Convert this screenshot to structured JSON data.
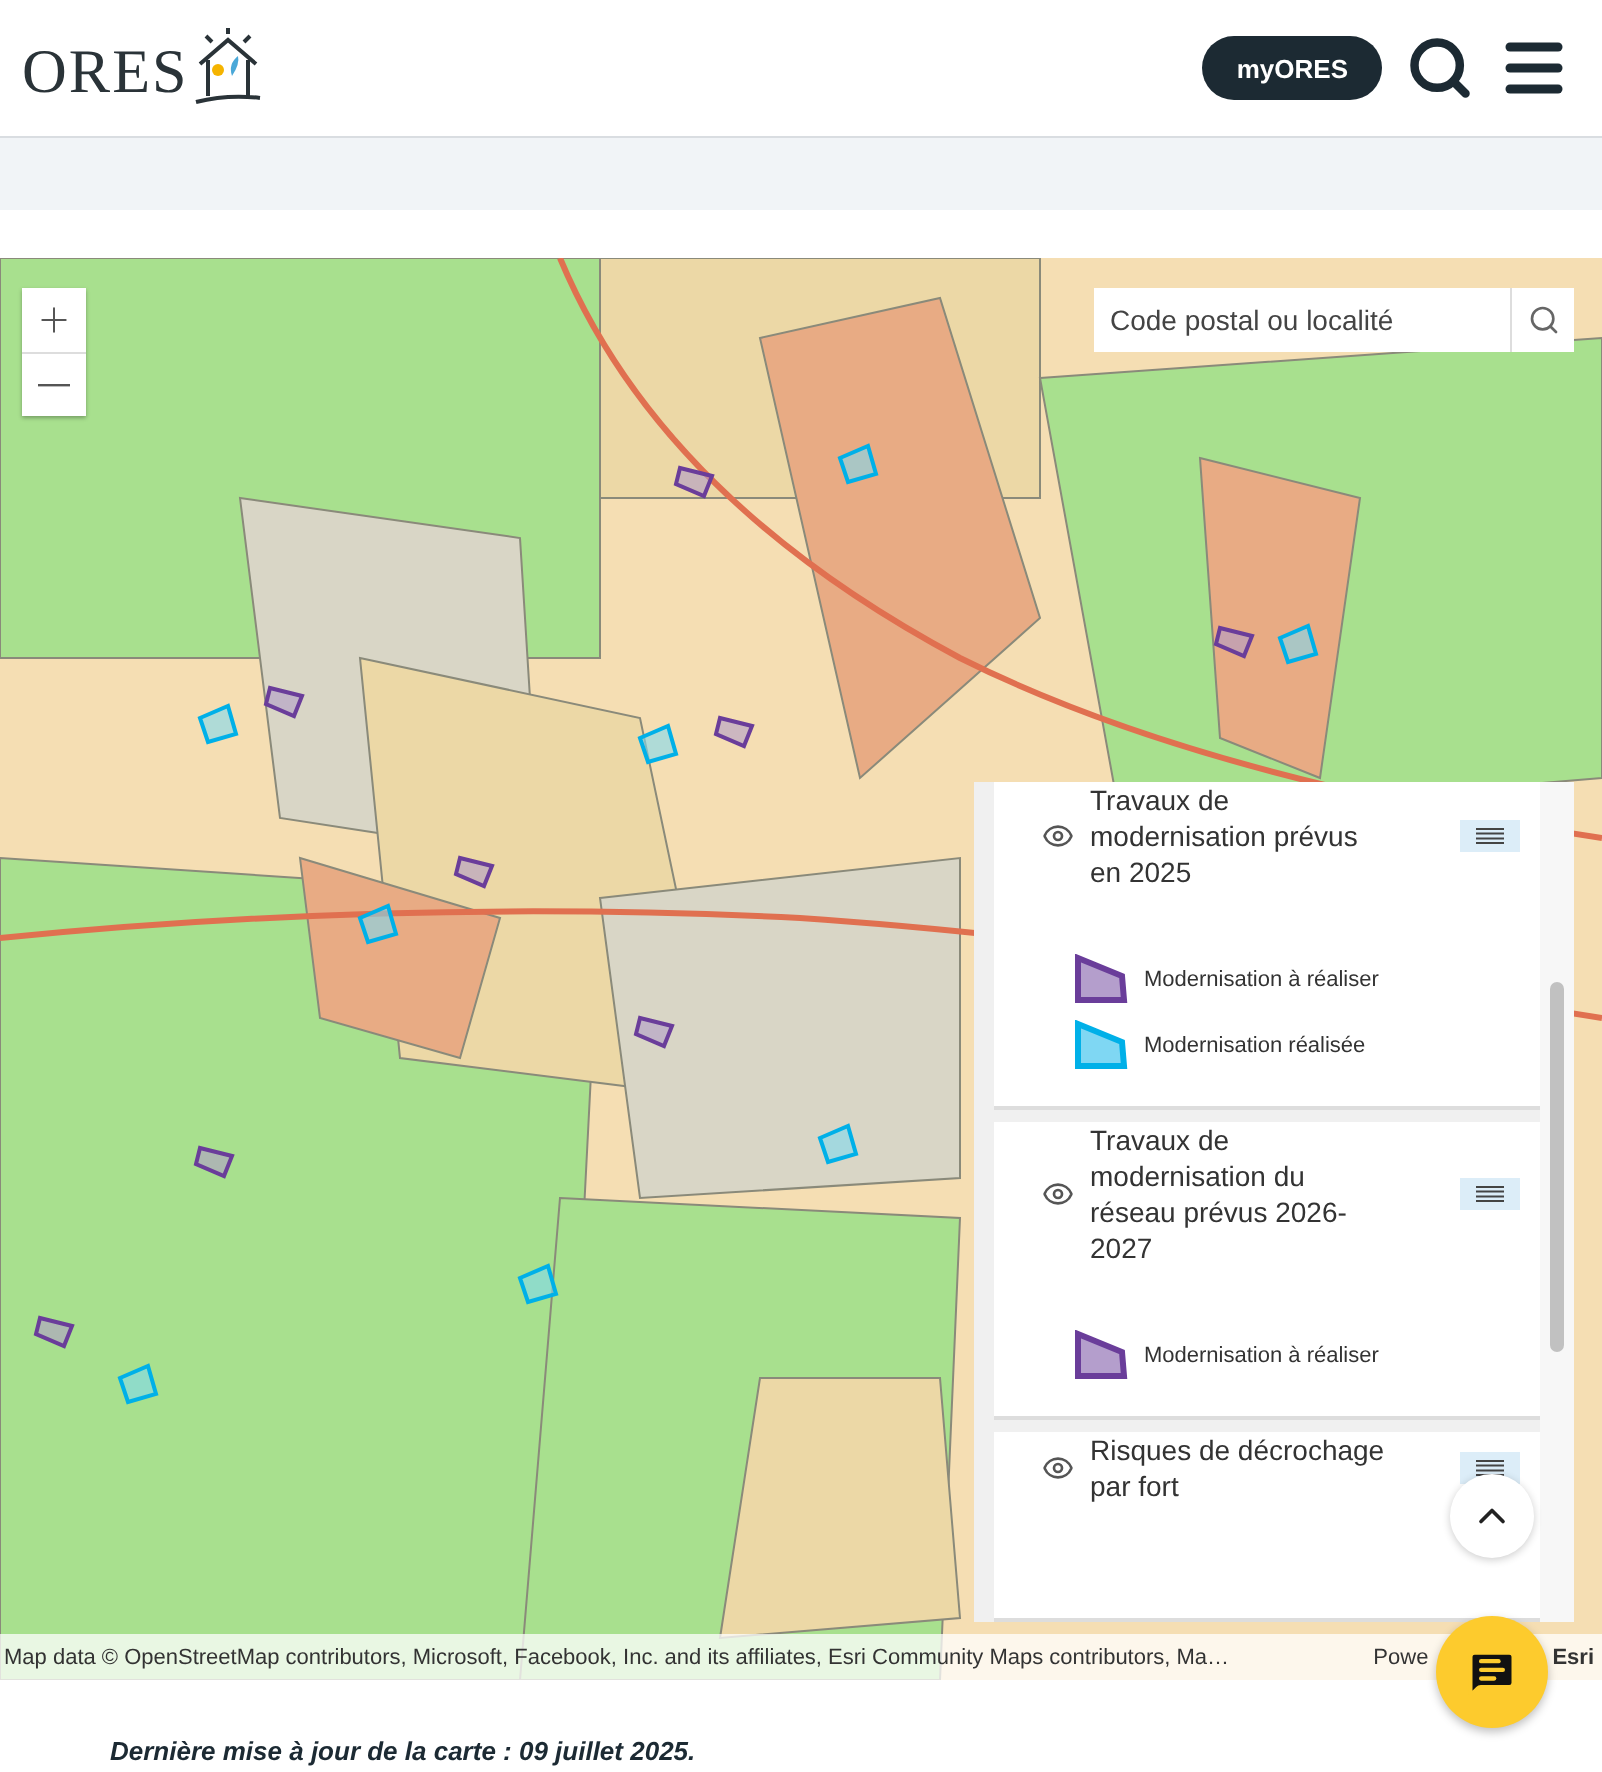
{
  "header": {
    "logo_text": "ORES",
    "account_button": "myORES"
  },
  "map": {
    "search": {
      "placeholder": "Code postal ou localité"
    },
    "legend": {
      "layers": [
        {
          "title": "Travaux de modernisation prévus en 2025",
          "visible": true,
          "items": [
            {
              "label": "Modernisation à réaliser",
              "color": "#6a3d9a"
            },
            {
              "label": "Modernisation réalisée",
              "color": "#00b0e8"
            }
          ]
        },
        {
          "title": "Travaux de modernisation du réseau prévus 2026-2027",
          "visible": true,
          "items": [
            {
              "label": "Modernisation à réaliser",
              "color": "#6a3d9a"
            }
          ]
        },
        {
          "title": "Risques de décrochage par fort",
          "visible": true
        }
      ]
    },
    "attribution": "Map data © OpenStreetMap contributors, Microsoft, Facebook, Inc. and its affiliates, Esri Community Maps contributors, Ma…",
    "powered_by": "Powe",
    "provider": "Esri"
  },
  "footer_note": "Dernière mise à jour de la carte : 09 juillet 2025."
}
